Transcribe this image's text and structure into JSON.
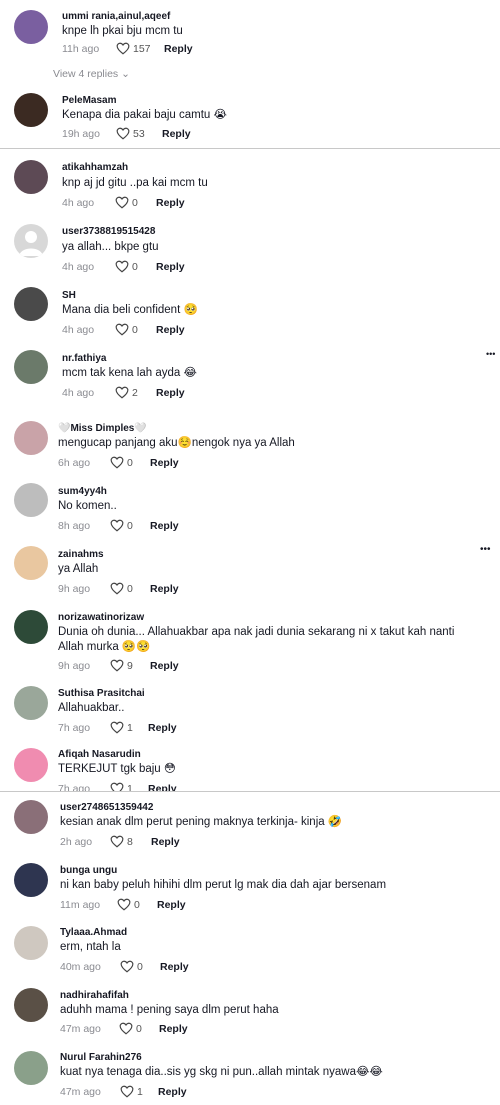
{
  "comments": [
    {
      "user": "ummi rania,ainul,aqeef",
      "text": "knpe lh pkai bju mcm tu",
      "time": "11h ago",
      "likes": "157",
      "reply": "Reply",
      "avatar_color": "#7a5fa0"
    },
    {
      "user": "PeleMasam",
      "text": "Kenapa dia pakai baju camtu 😭",
      "time": "19h ago",
      "likes": "53",
      "reply": "Reply",
      "avatar_color": "#3b2a22"
    },
    {
      "user": "atikahhamzah",
      "text": "knp aj jd gitu ..pa kai mcm tu",
      "time": "4h ago",
      "likes": "0",
      "reply": "Reply",
      "avatar_color": "#5d4a55"
    },
    {
      "user": "user3738819515428",
      "text": "ya allah... bkpe gtu",
      "time": "4h ago",
      "likes": "0",
      "reply": "Reply",
      "avatar_color": "#d8d8d8"
    },
    {
      "user": "SH",
      "text": "Mana dia beli confident 🥺",
      "time": "4h ago",
      "likes": "0",
      "reply": "Reply",
      "avatar_color": "#4a4a4a"
    },
    {
      "user": "nr.fathiya",
      "text": "mcm tak kena lah ayda 😂",
      "time": "4h ago",
      "likes": "2",
      "reply": "Reply",
      "avatar_color": "#6b7a6a"
    },
    {
      "user": "🤍Miss Dimples🤍",
      "text": "mengucap panjang aku☺️nengok nya ya Allah",
      "time": "6h ago",
      "likes": "0",
      "reply": "Reply",
      "avatar_color": "#c9a3a8"
    },
    {
      "user": "sum4yy4h",
      "text": "No komen..",
      "time": "8h ago",
      "likes": "0",
      "reply": "Reply",
      "avatar_color": "#bdbdbd"
    },
    {
      "user": "zainahms",
      "text": "ya Allah",
      "time": "9h ago",
      "likes": "0",
      "reply": "Reply",
      "avatar_color": "#e9c7a0"
    },
    {
      "user": "norizawatinorizaw",
      "text": "Dunia oh dunia... Allahuakbar apa nak jadi dunia sekarang ni x takut kah nanti Allah murka 🥺🥺",
      "time": "9h ago",
      "likes": "9",
      "reply": "Reply",
      "avatar_color": "#2d4a38"
    },
    {
      "user": "Suthisa Prasitchai",
      "text": "Allahuakbar..",
      "time": "7h ago",
      "likes": "1",
      "reply": "Reply",
      "avatar_color": "#9aa79a"
    },
    {
      "user": "Afiqah Nasarudin",
      "text": "TERKEJUT tgk baju 😳",
      "time": "7h ago",
      "likes": "1",
      "reply": "Reply",
      "avatar_color": "#f08cb0"
    },
    {
      "user": "user2748651359442",
      "text": "kesian anak dlm perut pening maknya terkinja- kinja 🤣",
      "time": "2h ago",
      "likes": "8",
      "reply": "Reply",
      "avatar_color": "#8a6f78"
    },
    {
      "user": "bunga ungu",
      "text": "ni kan baby peluh hihihi dlm perut lg mak dia dah ajar bersenam",
      "time": "11m ago",
      "likes": "0",
      "reply": "Reply",
      "avatar_color": "#2e3550"
    },
    {
      "user": "Tylaaa.Ahmad",
      "text": "erm, ntah la",
      "time": "40m ago",
      "likes": "0",
      "reply": "Reply",
      "avatar_color": "#cfc8c0"
    },
    {
      "user": "nadhirahafifah",
      "text": "aduhh mama ! pening saya dlm perut haha",
      "time": "47m ago",
      "likes": "0",
      "reply": "Reply",
      "avatar_color": "#5a5046"
    },
    {
      "user": "Nurul Farahin276",
      "text": "kuat nya tenaga dia..sis yg skg ni pun..allah mintak nyawa😂😂",
      "time": "47m ago",
      "likes": "1",
      "reply": "Reply",
      "avatar_color": "#8aa08a"
    }
  ],
  "view_replies": "View 4 replies",
  "more_icon": "•••"
}
